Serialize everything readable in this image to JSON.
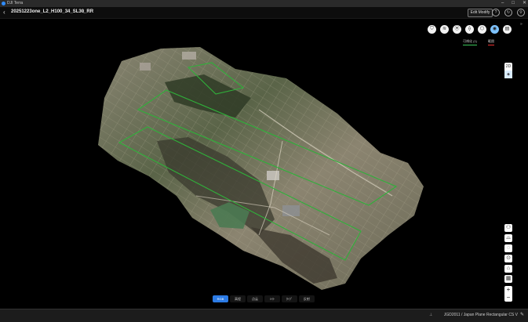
{
  "app": {
    "name": "DJI Terra"
  },
  "header": {
    "project_title": "20251223one_L2_H100_34_SL30_RR",
    "edit_title_icon": "✎",
    "back_icon": "‹",
    "edit_modify_label": "Edit Modify"
  },
  "toolbar": {
    "tools": [
      {
        "name": "filter-icon",
        "glyph": "⛉"
      },
      {
        "name": "layers-icon",
        "glyph": "≋"
      },
      {
        "name": "pin-icon",
        "glyph": "⦿"
      },
      {
        "name": "measure-icon",
        "glyph": "⟠"
      },
      {
        "name": "polygon-icon",
        "glyph": "⬡"
      },
      {
        "name": "view-icon",
        "glyph": "◉"
      },
      {
        "name": "settings-icon",
        "glyph": "▤"
      }
    ],
    "labels": [
      "可視化 (1)",
      "範囲"
    ]
  },
  "view_toggle": {
    "mode_2d": "2D",
    "mode_3d": "◈"
  },
  "right_tools": [
    "⚇",
    "⌓",
    "◌",
    "⊙",
    "⌂",
    "▦"
  ],
  "zoom": {
    "in": "+",
    "out": "−"
  },
  "bottom_tabs": [
    "RGB",
    "高程",
    "点云",
    "ﾊｲﾄ",
    "ﾀｲﾌﾟ",
    "反射"
  ],
  "side_toggle": "»",
  "statusbar": {
    "crs": "JGD2011 / Japan Plane Rectangular CS V",
    "edit_icon": "✎",
    "crs_icon": "⊥"
  },
  "colors": {
    "accent": "#2c7be5",
    "route": "#2fb13a",
    "range": "#e33333"
  }
}
